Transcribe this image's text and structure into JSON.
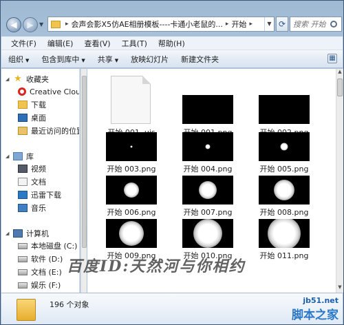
{
  "address": {
    "path": "会声会影X5仿AE相册模板----卡通小老鼠的...",
    "current": "开始",
    "search_placeholder": "搜索 开始"
  },
  "menu": [
    "文件(F)",
    "编辑(E)",
    "查看(V)",
    "工具(T)",
    "帮助(H)"
  ],
  "toolbar": [
    "组织",
    "包含到库中",
    "共享",
    "放映幻灯片",
    "新建文件夹"
  ],
  "nav": {
    "favorites": "收藏夹",
    "favorites_items": [
      "Creative Cloud",
      "下载",
      "桌面",
      "最近访问的位置"
    ],
    "library": "库",
    "library_items": [
      "视频",
      "文档",
      "迅雷下载",
      "音乐"
    ],
    "computer": "计算机",
    "computer_items": [
      "本地磁盘 (C:)",
      "软件 (D:)",
      "文档 (E:)",
      "娱乐 (F:)"
    ]
  },
  "files": [
    {
      "name": "开始 001 .uis",
      "type": "doc"
    },
    {
      "name": "开始 001.png",
      "glow": 0
    },
    {
      "name": "开始 002.png",
      "glow": 0
    },
    {
      "name": "开始 003.png",
      "glow": 3
    },
    {
      "name": "开始 004.png",
      "glow": 7
    },
    {
      "name": "开始 005.png",
      "glow": 11
    },
    {
      "name": "开始 006.png",
      "glow": 22
    },
    {
      "name": "开始 007.png",
      "glow": 26
    },
    {
      "name": "开始 008.png",
      "glow": 30
    },
    {
      "name": "开始 009.png",
      "glow": 36
    },
    {
      "name": "开始 010.png",
      "glow": 42
    },
    {
      "name": "开始 011.png",
      "glow": 48
    }
  ],
  "watermark": "百度ID:天然河与你相约",
  "status": {
    "count": "196 个对象"
  },
  "site": {
    "url": "jb51.net",
    "name": "脚本之家"
  }
}
